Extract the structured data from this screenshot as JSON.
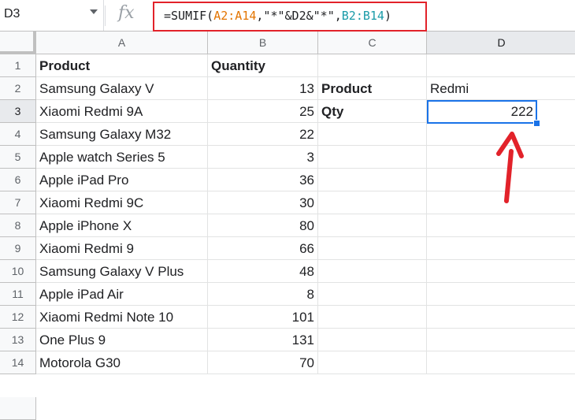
{
  "formula_bar": {
    "cell_ref": "D3",
    "fx": "fx",
    "formula_parts": [
      {
        "text": "=SUMIF(",
        "color": "default"
      },
      {
        "text": "A2:A14",
        "color": "orange"
      },
      {
        "text": ",\"*\"&D2&\"*\",",
        "color": "default"
      },
      {
        "text": "B2:B14",
        "color": "blue"
      },
      {
        "text": ")",
        "color": "default"
      }
    ]
  },
  "columns": [
    "A",
    "B",
    "C",
    "D"
  ],
  "rows": [
    "1",
    "2",
    "3",
    "4",
    "5",
    "6",
    "7",
    "8",
    "9",
    "10",
    "11",
    "12",
    "13",
    "14"
  ],
  "cells": {
    "A": [
      "Product",
      "Samsung Galaxy V",
      "Xiaomi Redmi 9A",
      "Samsung Galaxy M32",
      "Apple watch Series 5",
      "Apple iPad Pro",
      "Xiaomi Redmi 9C",
      "Apple iPhone X",
      "Xiaomi Redmi 9",
      "Samsung Galaxy V Plus",
      "Apple iPad Air",
      "Xiaomi Redmi Note 10",
      "One Plus 9",
      "Motorola G30"
    ],
    "B": [
      "Quantity",
      "13",
      "25",
      "22",
      "3",
      "36",
      "30",
      "80",
      "66",
      "48",
      "8",
      "101",
      "131",
      "70"
    ],
    "C2": "Product",
    "C3": "Qty",
    "D2": "Redmi",
    "D3": "222"
  },
  "active_cell": "D3",
  "colors": {
    "highlight_border": "#e2222a",
    "selection": "#1a73e8",
    "arrow": "#e2222a"
  }
}
